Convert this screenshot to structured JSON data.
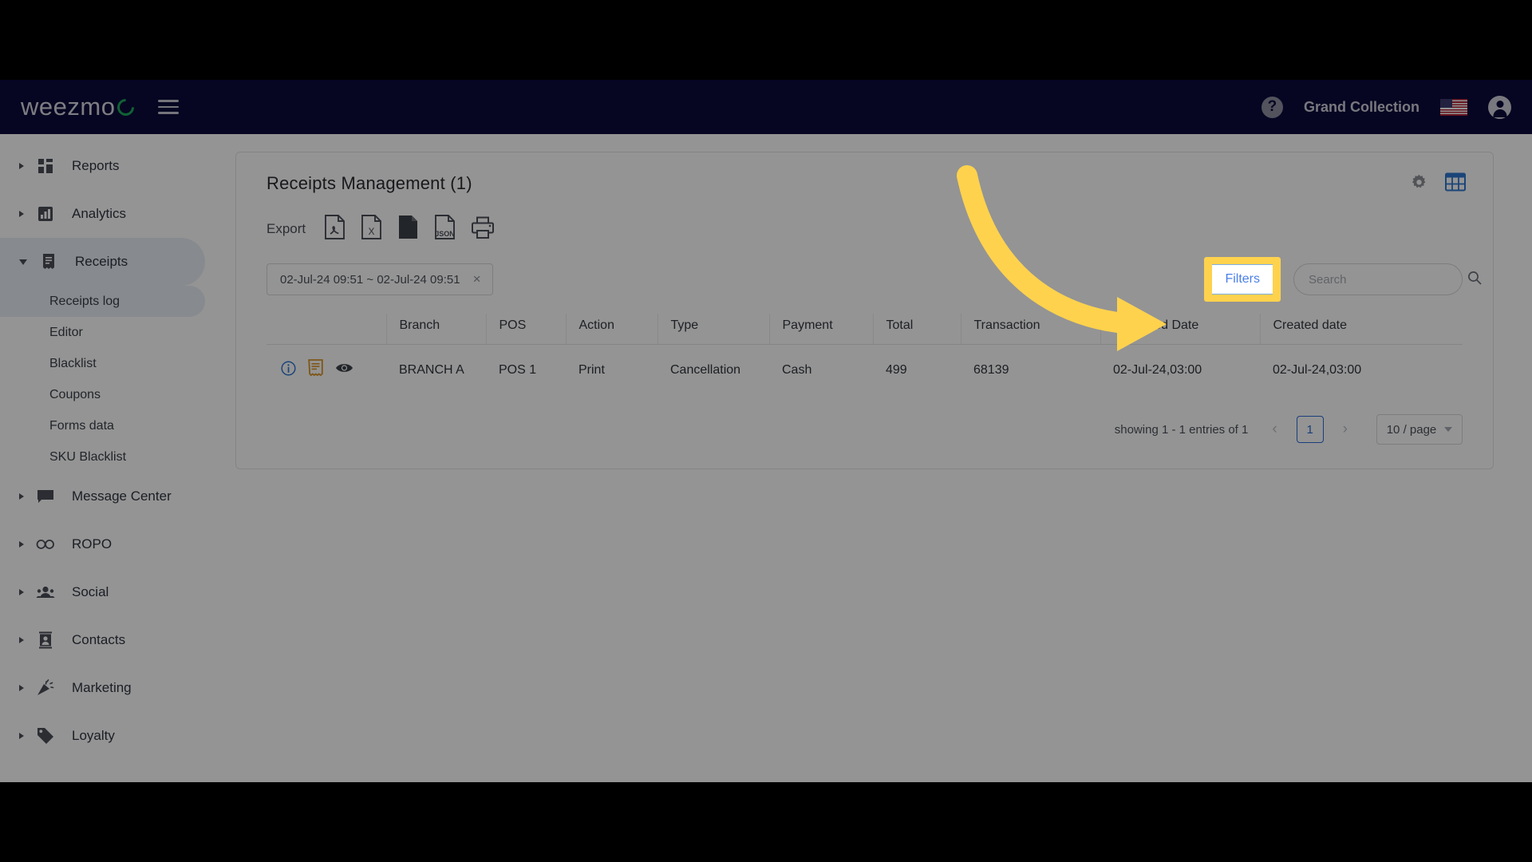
{
  "topbar": {
    "brand": "weezmo",
    "menu_icon": "hamburger-icon",
    "help_label": "?",
    "account_name": "Grand Collection",
    "flag": "us-flag-icon",
    "avatar": "user-avatar-icon"
  },
  "sidebar": {
    "groups": [
      {
        "label": "Reports",
        "icon": "dashboard-icon",
        "expanded": false,
        "active": false,
        "children": []
      },
      {
        "label": "Analytics",
        "icon": "bar-chart-icon",
        "expanded": false,
        "active": false,
        "children": []
      },
      {
        "label": "Receipts",
        "icon": "receipt-icon",
        "expanded": true,
        "active": true,
        "children": [
          {
            "label": "Receipts log",
            "active": true
          },
          {
            "label": "Editor",
            "active": false
          },
          {
            "label": "Blacklist",
            "active": false
          },
          {
            "label": "Coupons",
            "active": false
          },
          {
            "label": "Forms data",
            "active": false
          },
          {
            "label": "SKU Blacklist",
            "active": false
          }
        ]
      },
      {
        "label": "Message Center",
        "icon": "chat-bubble-icon",
        "expanded": false,
        "active": false,
        "children": []
      },
      {
        "label": "ROPO",
        "icon": "infinity-icon",
        "expanded": false,
        "active": false,
        "children": []
      },
      {
        "label": "Social",
        "icon": "people-icon",
        "expanded": false,
        "active": false,
        "children": []
      },
      {
        "label": "Contacts",
        "icon": "contact-card-icon",
        "expanded": false,
        "active": false,
        "children": []
      },
      {
        "label": "Marketing",
        "icon": "party-popper-icon",
        "expanded": false,
        "active": false,
        "children": []
      },
      {
        "label": "Loyalty",
        "icon": "tag-icon",
        "expanded": false,
        "active": false,
        "children": []
      }
    ]
  },
  "main": {
    "title": "Receipts Management (1)",
    "tools": {
      "settings": "gear-icon",
      "columns": "spreadsheet-icon"
    },
    "export": {
      "label": "Export",
      "options": [
        {
          "name": "pdf-export-icon",
          "text": ""
        },
        {
          "name": "excel-export-icon",
          "text": "X"
        },
        {
          "name": "csv-export-icon",
          "text": ""
        },
        {
          "name": "json-export-icon",
          "text": "JSON"
        },
        {
          "name": "print-icon",
          "text": ""
        }
      ]
    },
    "date_filter": {
      "value": "02-Jul-24 09:51 ~ 02-Jul-24 09:51",
      "clear": "×"
    },
    "filters_button": "Filters",
    "search": {
      "value": "",
      "placeholder": "Search",
      "icon": "search-icon"
    },
    "table": {
      "columns": [
        "",
        "Branch",
        "POS",
        "Action",
        "Type",
        "Payment",
        "Total",
        "Transaction",
        "Uploaded Date",
        "Created date"
      ],
      "rows": [
        {
          "icons": [
            "info-icon",
            "receipt-view-icon",
            "eye-icon"
          ],
          "branch": "BRANCH A",
          "pos": "POS 1",
          "action": "Print",
          "type": "Cancellation",
          "payment": "Cash",
          "total": "499",
          "transaction": "68139",
          "uploaded_date": "02-Jul-24,03:00",
          "created_date": "02-Jul-24,03:00"
        }
      ]
    },
    "pagination": {
      "summary": "showing 1 - 1 entries of 1",
      "prev": "‹",
      "current_page": "1",
      "next": "›",
      "per_page": "10 / page"
    }
  },
  "annotation": {
    "highlight_target": "Filters",
    "highlight_color": "#ffd24d",
    "arrow_color": "#ffd24d"
  }
}
